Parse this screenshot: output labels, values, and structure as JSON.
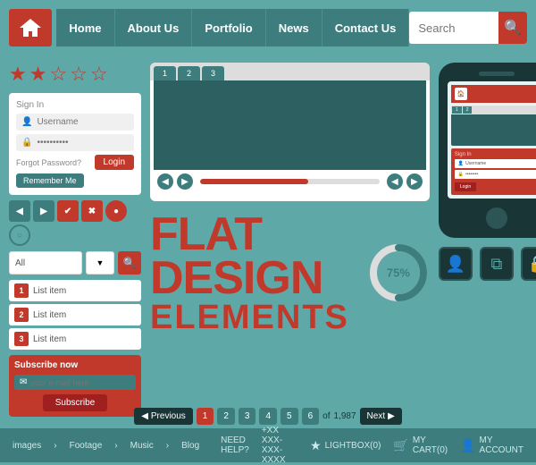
{
  "navbar": {
    "logo_alt": "home-logo",
    "items": [
      {
        "label": "Home",
        "id": "home"
      },
      {
        "label": "About Us",
        "id": "about"
      },
      {
        "label": "Portfolio",
        "id": "portfolio"
      },
      {
        "label": "News",
        "id": "news"
      },
      {
        "label": "Contact Us",
        "id": "contact"
      }
    ],
    "search_placeholder": "Search",
    "search_label": "Search"
  },
  "left_panel": {
    "login": {
      "title": "Sign In",
      "username_placeholder": "Username",
      "password_placeholder": "••••••••••",
      "login_btn": "Login",
      "forgot_label": "Forgot Password?",
      "remember_label": "Remember Me"
    },
    "nav_buttons": [
      "◀",
      "▶",
      "✔",
      "✖",
      "●",
      "○"
    ],
    "dropdown": {
      "value": "All",
      "placeholder": "All"
    },
    "list_items": [
      {
        "num": "1",
        "text": "List item"
      },
      {
        "num": "2",
        "text": "List item"
      },
      {
        "num": "3",
        "text": "List item"
      }
    ],
    "subscribe": {
      "title": "Subscribe now",
      "email_placeholder": "your e-mail here",
      "btn_label": "Subscribe"
    }
  },
  "center": {
    "browser": {
      "tabs": [
        "1",
        "2",
        "3"
      ],
      "progress_percent": 60
    },
    "flat_text": {
      "line1": "FLAT",
      "line2": "DESIGN",
      "line3": "ELEMENTS"
    },
    "donut": {
      "percent": 75,
      "label": "75%"
    }
  },
  "phone": {
    "icon_boxes": [
      "👤",
      "⧉",
      "🔒"
    ]
  },
  "pagination": {
    "prev_label": "Previous",
    "next_label": "Next",
    "pages": [
      "1",
      "2",
      "3",
      "4",
      "5",
      "6"
    ],
    "of_label": "of",
    "total": "1,987"
  },
  "footer": {
    "links": [
      "images",
      "Footage",
      "Music",
      "Blog"
    ],
    "need_help": "NEED HELP?",
    "phone": "+XX XXX-XXX-XXXX",
    "lightbox": "LIGHTBOX(0)",
    "cart": "MY CART(0)",
    "account": "MY ACCOUNT"
  }
}
